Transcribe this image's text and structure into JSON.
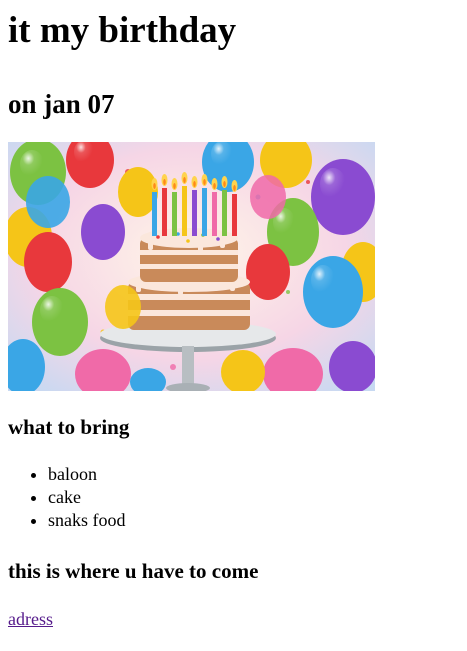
{
  "page": {
    "title": "it my birthday",
    "date": "on jan 07"
  },
  "image": {
    "alt": "birthday cake with candles and colorful balloons",
    "colors": {
      "balloon_red": "#e8383c",
      "balloon_yellow": "#f5c518",
      "balloon_blue": "#3aa6e6",
      "balloon_purple": "#8a4bd1",
      "balloon_green": "#7cc242",
      "balloon_pink": "#f06aa8",
      "cake_sponge": "#c98a5a",
      "cake_cream": "#fbe7dc",
      "plate": "#e6e8ea"
    }
  },
  "bring": {
    "heading": "what to bring",
    "items": [
      "baloon",
      "cake",
      "snaks food"
    ]
  },
  "location": {
    "heading": "this is where u have to come",
    "link_text": "adress"
  }
}
